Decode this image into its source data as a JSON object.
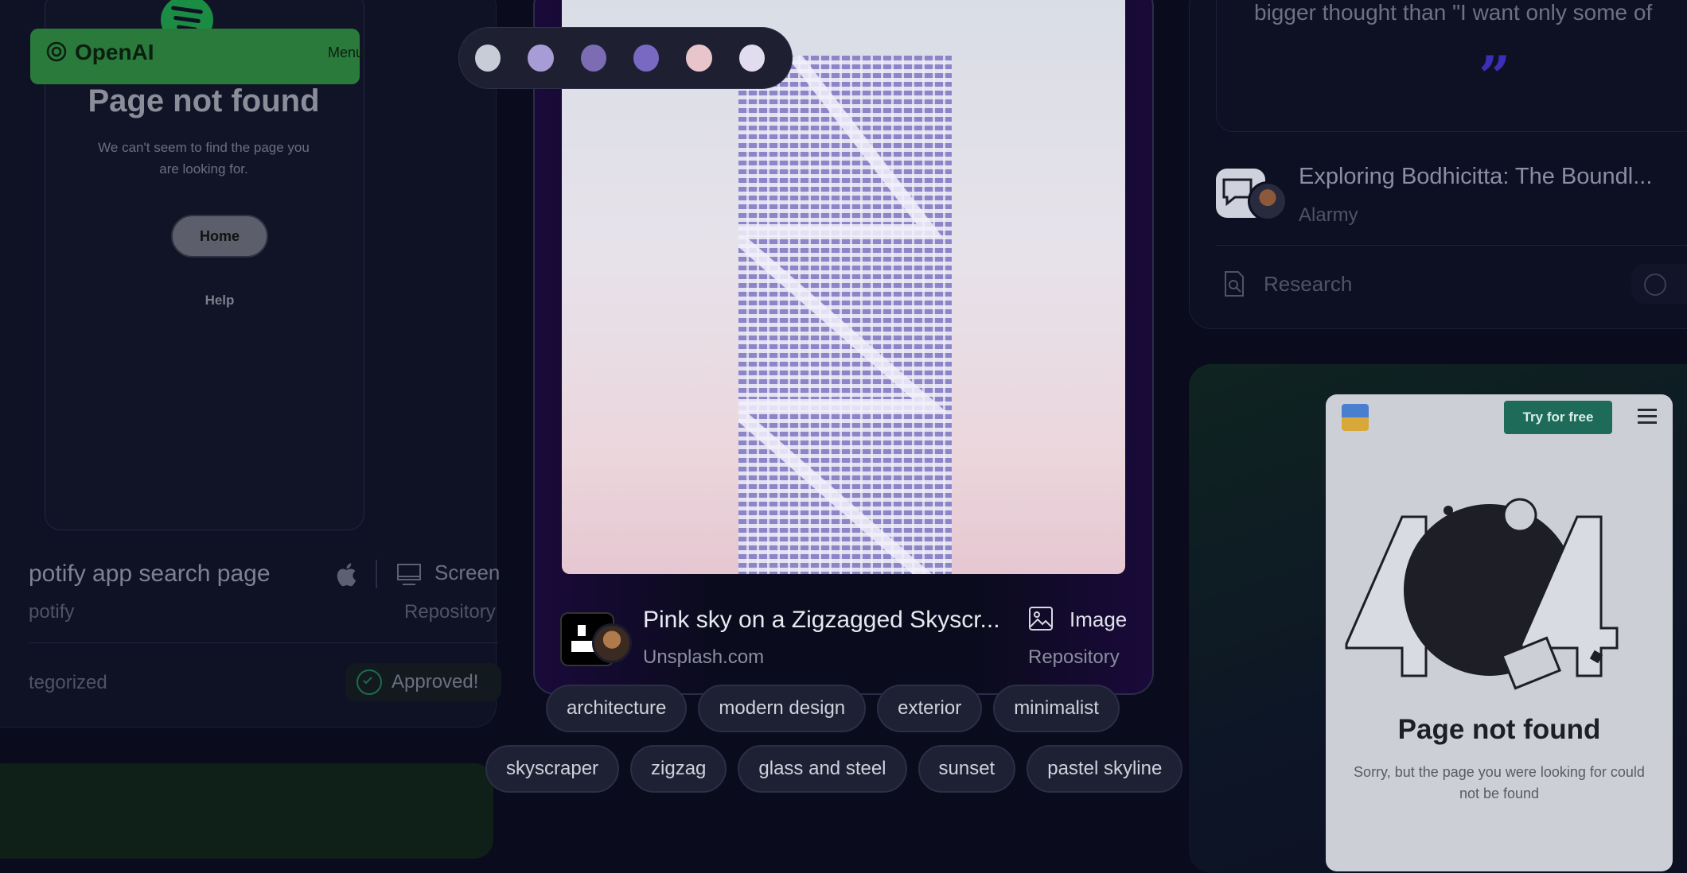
{
  "left_card": {
    "page_not_found_title": "Page not found",
    "page_not_found_sub": "We can't seem to find the page you are looking for.",
    "home_button": "Home",
    "help_link": "Help",
    "title": "potify app search page",
    "platform_label": "Screen",
    "subtitle": "potify",
    "type_label": "Repository",
    "category": "tegorized",
    "status": "Approved!"
  },
  "openai_card": {
    "brand": "OpenAI",
    "menu": "Menu"
  },
  "palette": {
    "colors": [
      "#c7ccd6",
      "#a79cd6",
      "#7b6cb3",
      "#7a69c2",
      "#e8c5cb",
      "#e2dcef"
    ]
  },
  "main_result": {
    "title": "Pink sky on a Zigzagged Skyscr...",
    "source": "Unsplash.com",
    "media_type": "Image",
    "type_label": "Repository",
    "tags_row1": [
      "architecture",
      "modern design",
      "exterior",
      "minimalist"
    ],
    "tags_row2": [
      "skyscraper",
      "zigzag",
      "glass and steel",
      "sunset",
      "pastel skyline"
    ]
  },
  "right_top": {
    "quote_text": "bigger thought than \"I want only some of",
    "quote_mark": "”",
    "item_title": "Exploring Bodhicitta: The Boundl...",
    "item_source": "Alarmy",
    "action_label": "Research"
  },
  "right_bottom": {
    "try_button": "Try for free",
    "page_not_found_title": "Page not found",
    "page_not_found_sub": "Sorry, but the page you were looking for could not be found"
  }
}
